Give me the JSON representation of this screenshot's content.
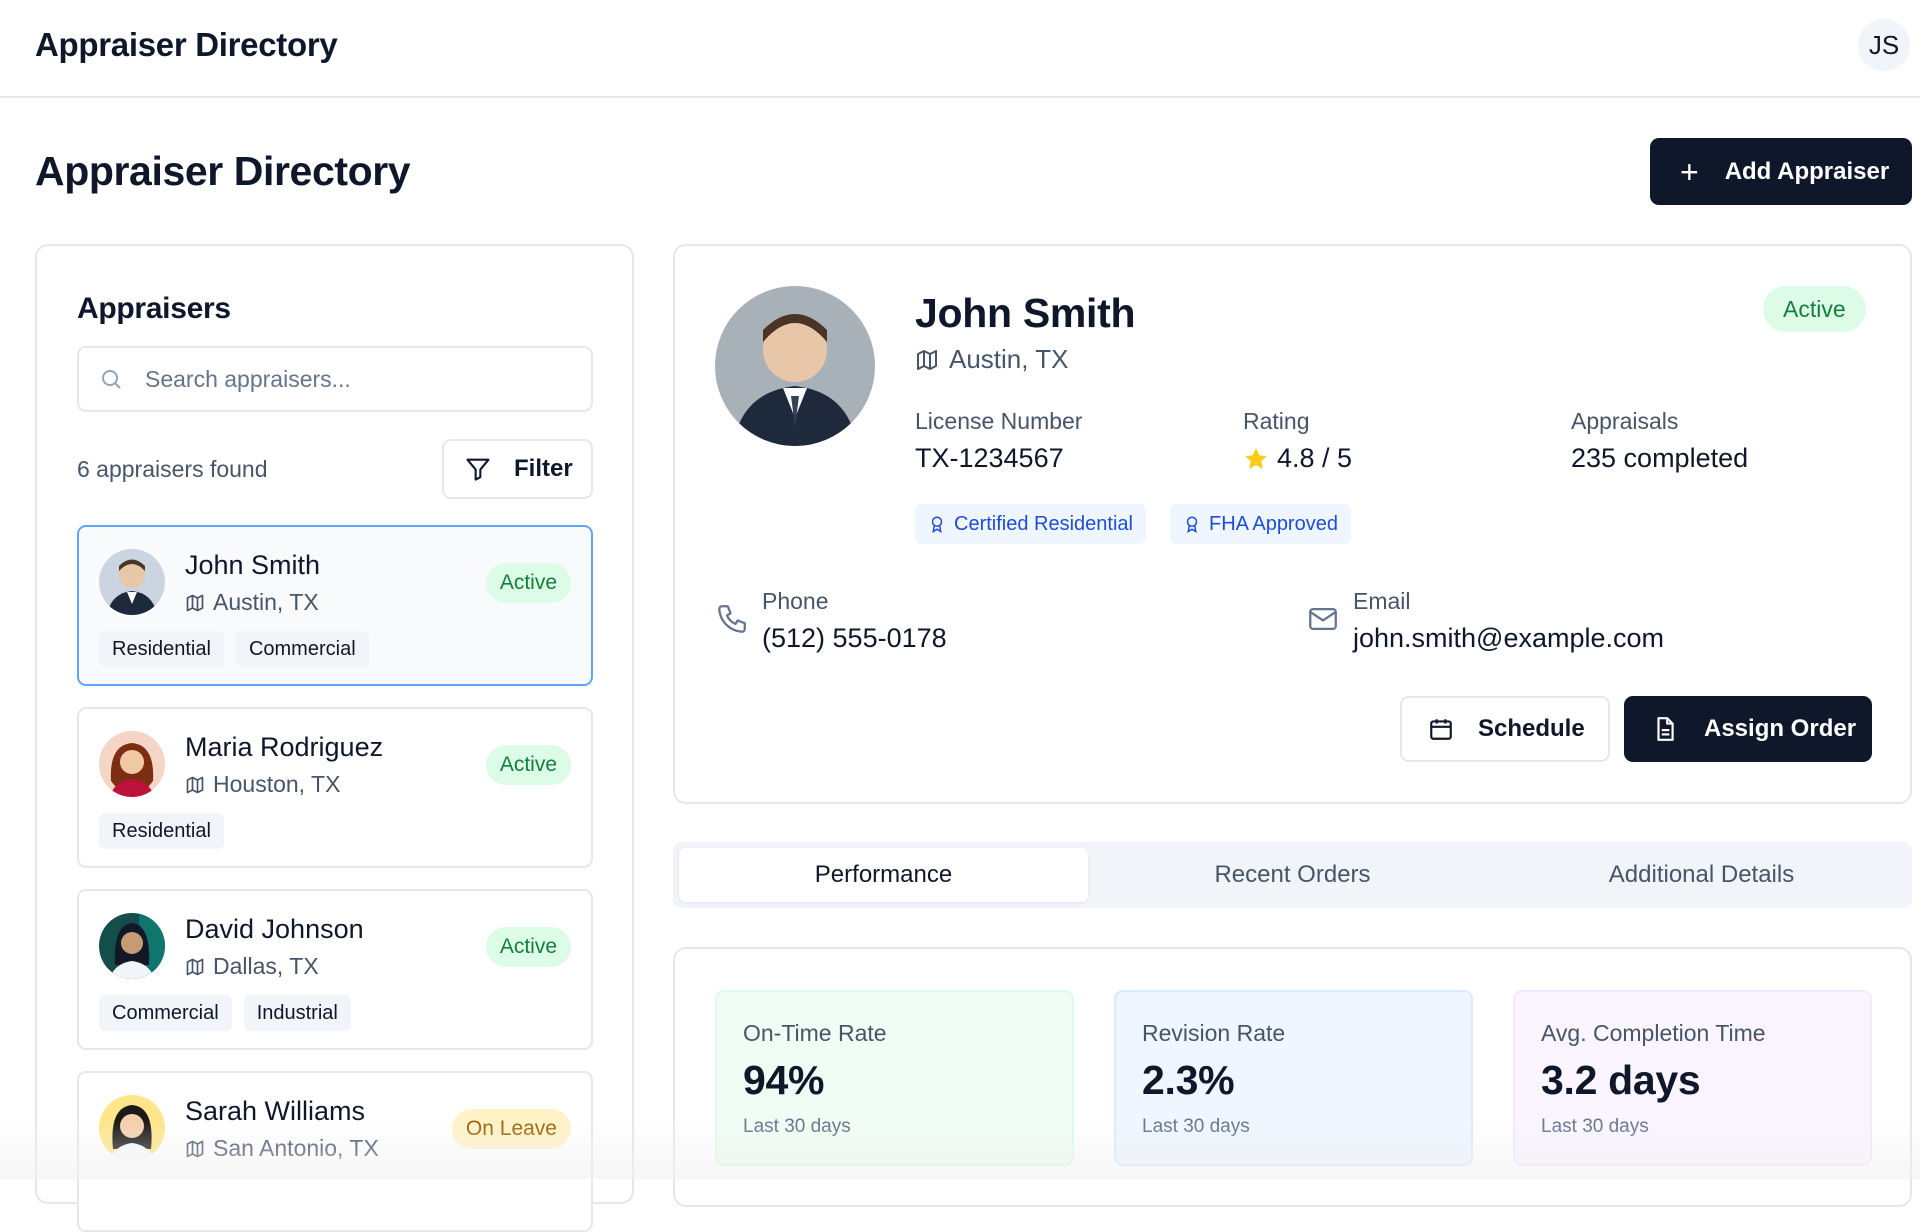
{
  "app": {
    "title": "Appraiser Directory",
    "user_initials": "JS"
  },
  "page": {
    "title": "Appraiser Directory",
    "add_button_label": "Add Appraiser"
  },
  "sidebar": {
    "heading": "Appraisers",
    "search_placeholder": "Search appraisers...",
    "result_count": "6 appraisers found",
    "filter_label": "Filter",
    "appraisers": [
      {
        "name": "John Smith",
        "location": "Austin, TX",
        "status": "Active",
        "tags": [
          "Residential",
          "Commercial"
        ]
      },
      {
        "name": "Maria Rodriguez",
        "location": "Houston, TX",
        "status": "Active",
        "tags": [
          "Residential"
        ]
      },
      {
        "name": "David Johnson",
        "location": "Dallas, TX",
        "status": "Active",
        "tags": [
          "Commercial",
          "Industrial"
        ]
      },
      {
        "name": "Sarah Williams",
        "location": "San Antonio, TX",
        "status": "On Leave",
        "tags": []
      }
    ]
  },
  "profile": {
    "name": "John Smith",
    "location": "Austin, TX",
    "status": "Active",
    "license_label": "License Number",
    "license_value": "TX-1234567",
    "rating_label": "Rating",
    "rating_value": "4.8 / 5",
    "appraisals_label": "Appraisals",
    "appraisals_value": "235 completed",
    "certifications": [
      "Certified Residential",
      "FHA Approved"
    ],
    "phone_label": "Phone",
    "phone_value": "(512) 555-0178",
    "email_label": "Email",
    "email_value": "john.smith@example.com",
    "schedule_label": "Schedule",
    "assign_label": "Assign Order"
  },
  "tabs": [
    "Performance",
    "Recent Orders",
    "Additional Details"
  ],
  "metrics": [
    {
      "label": "On-Time Rate",
      "value": "94%",
      "sub": "Last 30 days"
    },
    {
      "label": "Revision Rate",
      "value": "2.3%",
      "sub": "Last 30 days"
    },
    {
      "label": "Avg. Completion Time",
      "value": "3.2 days",
      "sub": "Last 30 days"
    }
  ],
  "colors": {
    "primary": "#0f172a",
    "active_bg": "#dcfce7",
    "active_text": "#15803d",
    "leave_bg": "#fef3c7",
    "leave_text": "#a16207",
    "cert_text": "#1d4ed8"
  }
}
